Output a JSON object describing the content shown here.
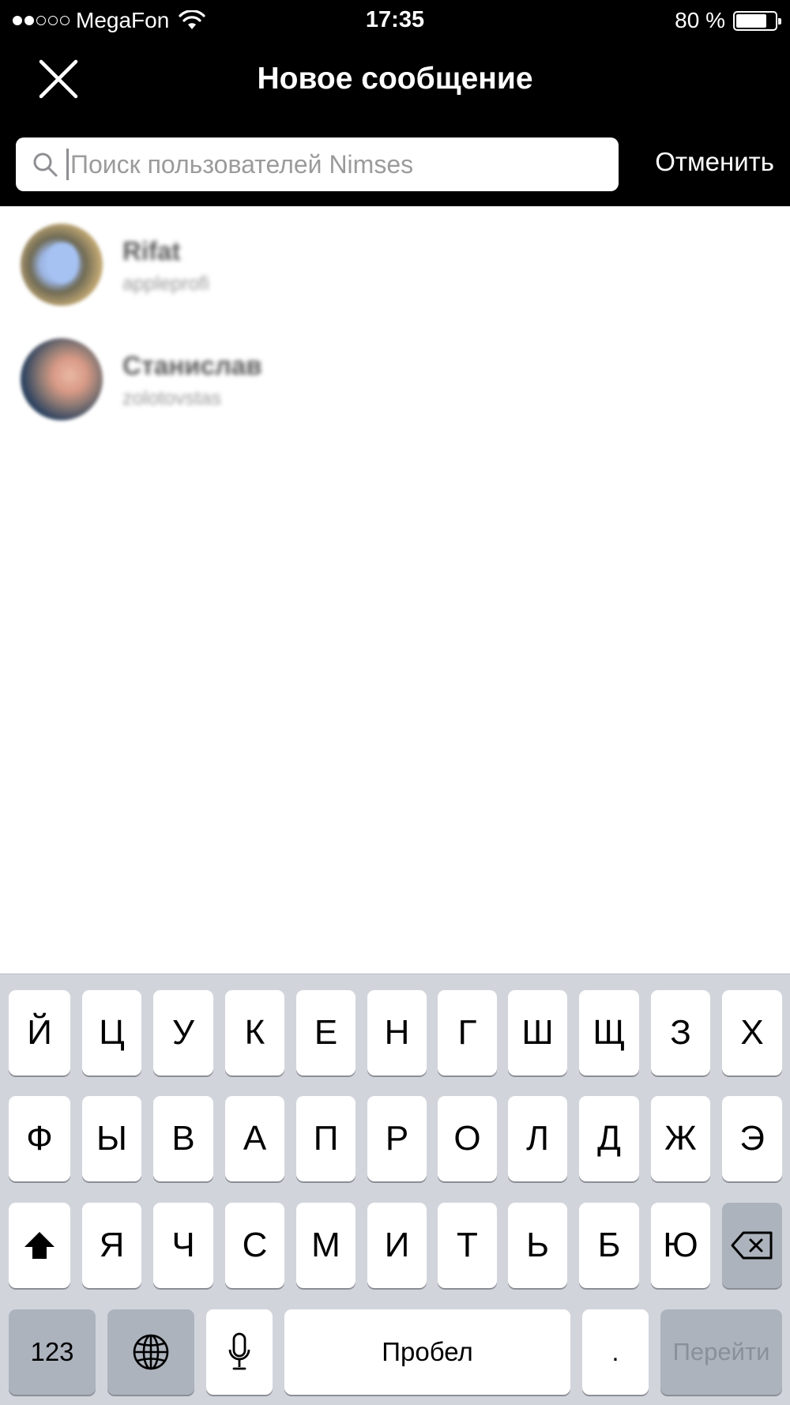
{
  "status_bar": {
    "carrier": "MegaFon",
    "time": "17:35",
    "battery_percent": "80 %",
    "battery_level": 0.8,
    "signal_bars_filled": 2,
    "signal_bars_total": 5
  },
  "header": {
    "title": "Новое сообщение",
    "close_icon": "close-icon"
  },
  "search": {
    "placeholder": "Поиск пользователей Nimses",
    "value": "",
    "cancel_label": "Отменить"
  },
  "users": [
    {
      "name": "Rifat",
      "handle": "appleprofi"
    },
    {
      "name": "Станислав",
      "handle": "zolotovstas"
    }
  ],
  "keyboard": {
    "row1": [
      "Й",
      "Ц",
      "У",
      "К",
      "Е",
      "Н",
      "Г",
      "Ш",
      "Щ",
      "З",
      "Х"
    ],
    "row2": [
      "Ф",
      "Ы",
      "В",
      "А",
      "П",
      "Р",
      "О",
      "Л",
      "Д",
      "Ж",
      "Э"
    ],
    "row3": [
      "Я",
      "Ч",
      "С",
      "М",
      "И",
      "Т",
      "Ь",
      "Б",
      "Ю"
    ],
    "numbers_label": "123",
    "space_label": "Пробел",
    "period_label": ".",
    "go_label": "Перейти",
    "icons": [
      "shift-icon",
      "backspace-icon",
      "globe-icon",
      "microphone-icon"
    ]
  },
  "colors": {
    "header_bg": "#000000",
    "keyboard_bg": "#d1d5db",
    "key_bg": "#ffffff",
    "function_key_bg": "#adb3bd"
  }
}
